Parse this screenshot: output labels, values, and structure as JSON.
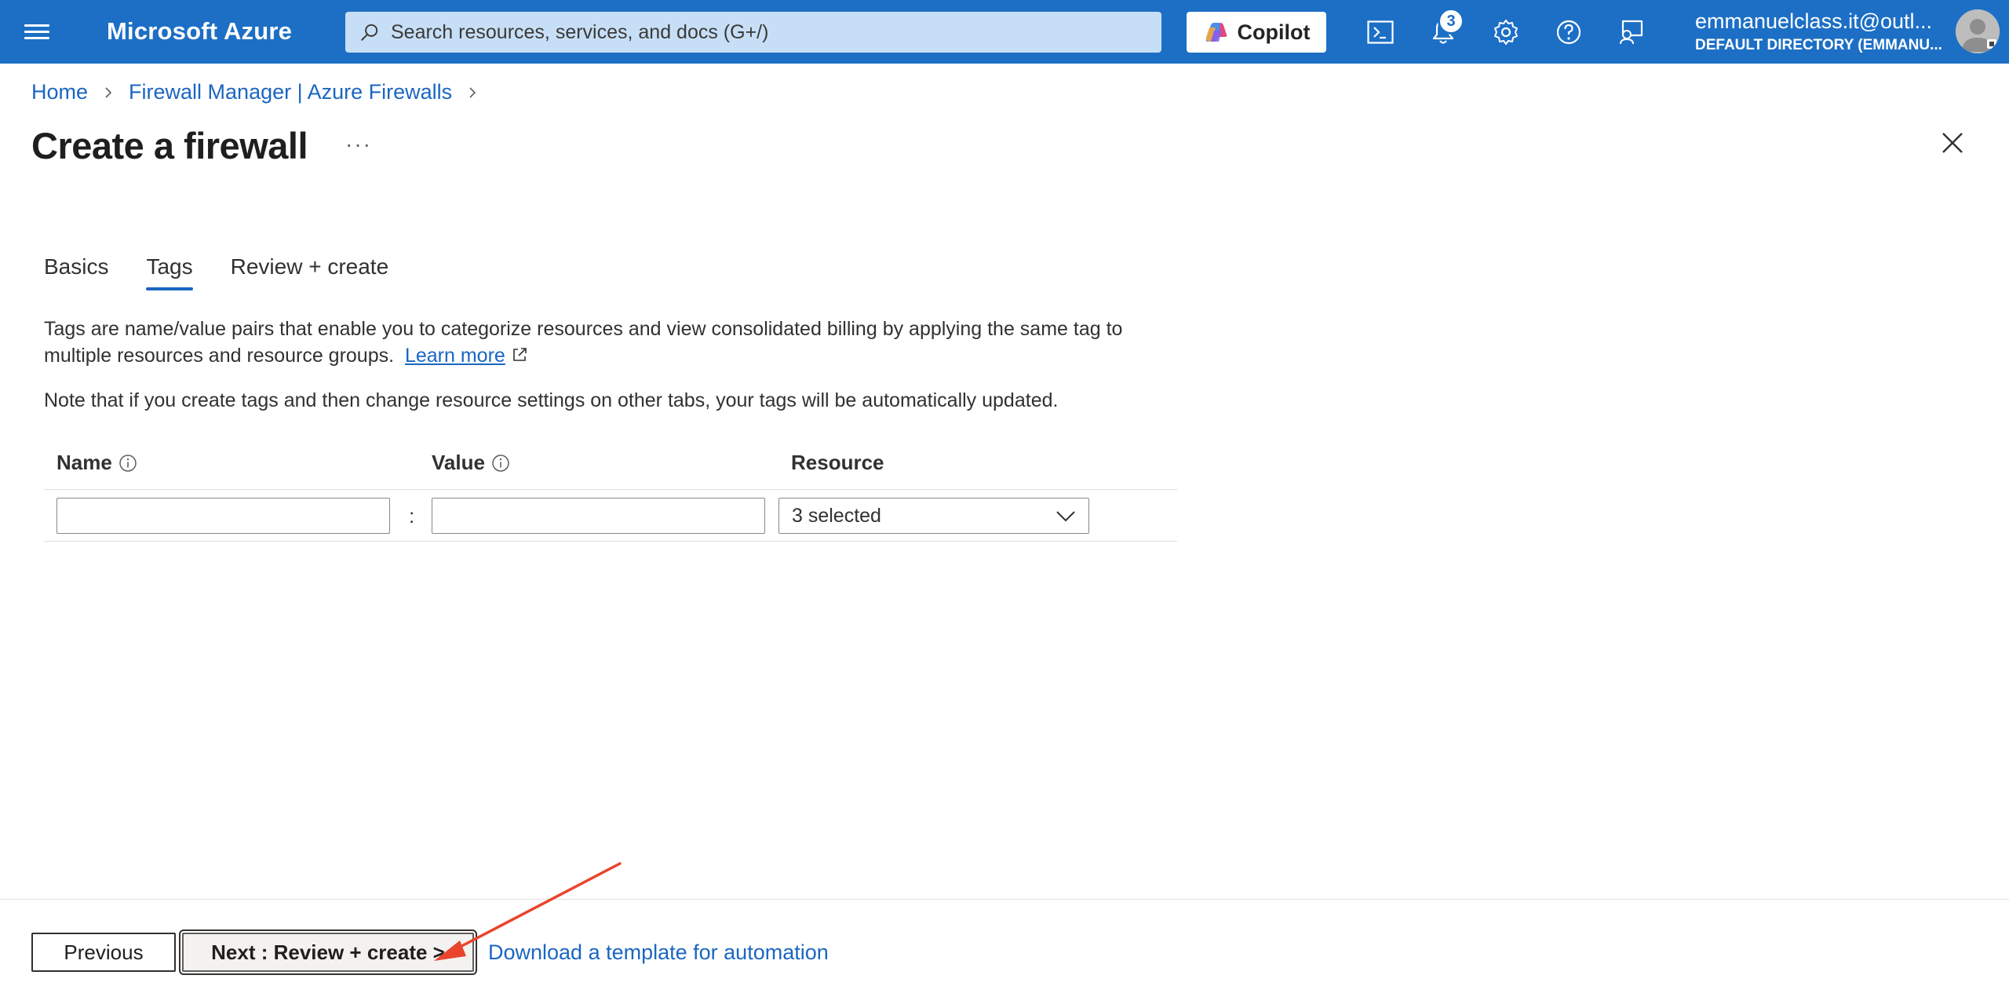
{
  "topbar": {
    "brand": "Microsoft Azure",
    "search_placeholder": "Search resources, services, and docs (G+/)",
    "copilot_label": "Copilot",
    "notifications_count": "3",
    "account_email": "emmanuelclass.it@outl...",
    "account_directory": "DEFAULT DIRECTORY (EMMANU...",
    "icons": [
      "menu-icon",
      "search-icon",
      "copilot-icon",
      "cloud-shell-icon",
      "bell-icon",
      "gear-icon",
      "help-icon",
      "feedback-icon",
      "avatar"
    ]
  },
  "breadcrumb": {
    "items": [
      "Home",
      "Firewall Manager | Azure Firewalls"
    ]
  },
  "page": {
    "title": "Create a firewall",
    "more": "···"
  },
  "tabs": [
    {
      "label": "Basics",
      "active": false
    },
    {
      "label": "Tags",
      "active": true
    },
    {
      "label": "Review + create",
      "active": false
    }
  ],
  "content": {
    "description": "Tags are name/value pairs that enable you to categorize resources and view consolidated billing by applying the same tag to multiple resources and resource groups.",
    "learn_more": "Learn more",
    "note": "Note that if you create tags and then change resource settings on other tabs, your tags will be automatically updated."
  },
  "table": {
    "headers": {
      "name": "Name",
      "value": "Value",
      "resource": "Resource"
    },
    "row": {
      "name": "",
      "separator": ":",
      "value": "",
      "resource": "3 selected"
    }
  },
  "footer": {
    "previous": "Previous",
    "next": "Next : Review + create >",
    "download": "Download a template for automation"
  },
  "colors": {
    "topbar": "#1c6fc5",
    "link": "#1a66c2",
    "annotation_arrow": "#e8452c"
  }
}
